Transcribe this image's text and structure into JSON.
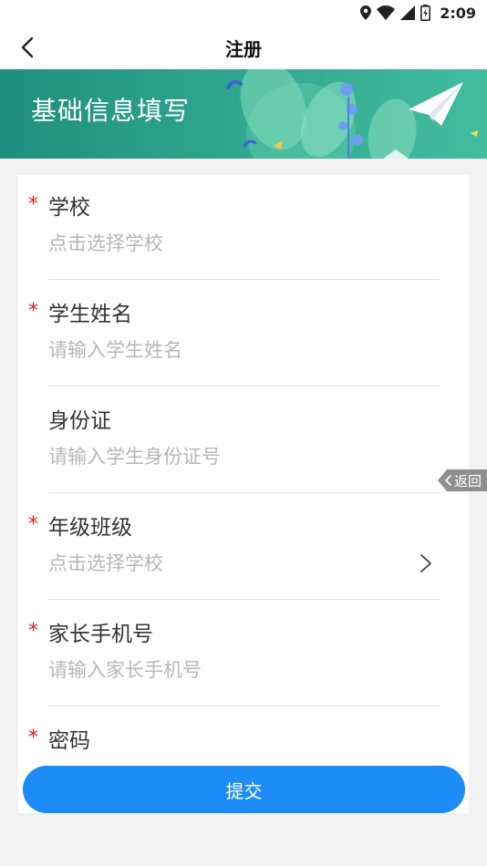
{
  "status_bar": {
    "time": "2:09",
    "icons": [
      "location-icon",
      "wifi-icon",
      "signal-icon",
      "battery-icon"
    ]
  },
  "nav": {
    "title": "注册",
    "back_icon": "chevron-left-icon"
  },
  "banner": {
    "title": "基础信息填写",
    "art": [
      "plant-illustration",
      "paper-plane-icon"
    ]
  },
  "form": {
    "required_mark": "*",
    "fields": [
      {
        "label": "学校",
        "placeholder": "点击选择学校",
        "required": true,
        "type": "select"
      },
      {
        "label": "学生姓名",
        "placeholder": "请输入学生姓名",
        "required": true,
        "type": "text"
      },
      {
        "label": "身份证",
        "placeholder": "请输入学生身份证号",
        "required": false,
        "type": "text"
      },
      {
        "label": "年级班级",
        "placeholder": "点击选择学校",
        "required": true,
        "type": "select",
        "icon": "chevron-right-icon"
      },
      {
        "label": "家长手机号",
        "placeholder": "请输入家长手机号",
        "required": true,
        "type": "text"
      },
      {
        "label": "密码",
        "required": true,
        "type": "password"
      }
    ]
  },
  "return_tab": {
    "label": "返回",
    "icon": "chevron-left-icon"
  },
  "submit": {
    "label": "提交"
  },
  "colors": {
    "accent": "#1e8cf6",
    "banner_green": "#2ea58d",
    "required_red": "#e0201a",
    "placeholder_gray": "#b7b7b7"
  }
}
